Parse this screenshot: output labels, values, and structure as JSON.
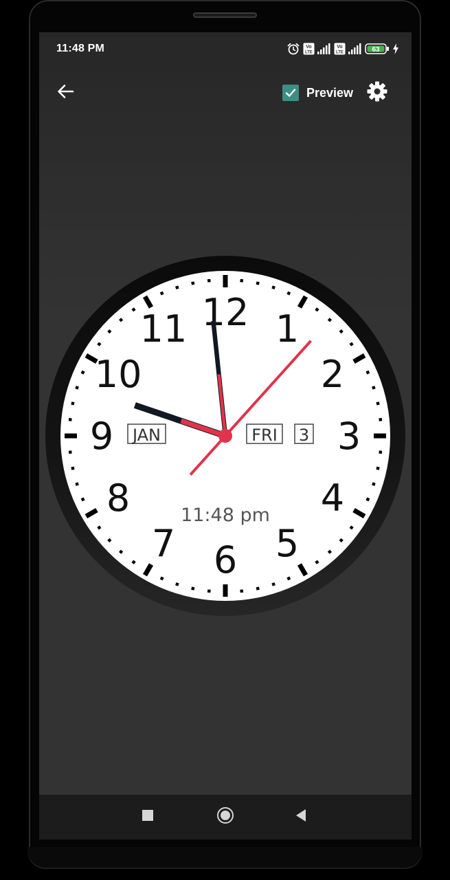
{
  "status_bar": {
    "time": "11:48 PM",
    "battery_level": "63",
    "volte_label": "Vo LTE",
    "icons": [
      "alarm-icon",
      "volte-icon",
      "signal-icon",
      "volte-icon",
      "signal-icon",
      "battery-icon",
      "charging-icon"
    ]
  },
  "toolbar": {
    "back_icon": "arrow-left-icon",
    "preview_label": "Preview",
    "preview_checked": true,
    "settings_icon": "gear-icon"
  },
  "clock": {
    "numbers": [
      "12",
      "1",
      "2",
      "3",
      "4",
      "5",
      "6",
      "7",
      "8",
      "9",
      "10",
      "11"
    ],
    "month": "JAN",
    "weekday": "FRI",
    "day": "3",
    "digital_time": "11:48 pm",
    "time": {
      "hours": 11,
      "minutes": 48,
      "seconds": 7
    },
    "colors": {
      "face": "#ffffff",
      "bezel": "#0d0d0d",
      "hand": "#111822",
      "second_hand": "#e0344a",
      "text": "#111111",
      "digital_text": "#555555"
    }
  },
  "navbar": {
    "recents_icon": "square-icon",
    "home_icon": "circle-icon",
    "back_icon": "triangle-back-icon"
  },
  "colors": {
    "checkbox": "#3f8d82",
    "screen_bg": "#333333",
    "navbar_bg": "#1c1c1c"
  }
}
